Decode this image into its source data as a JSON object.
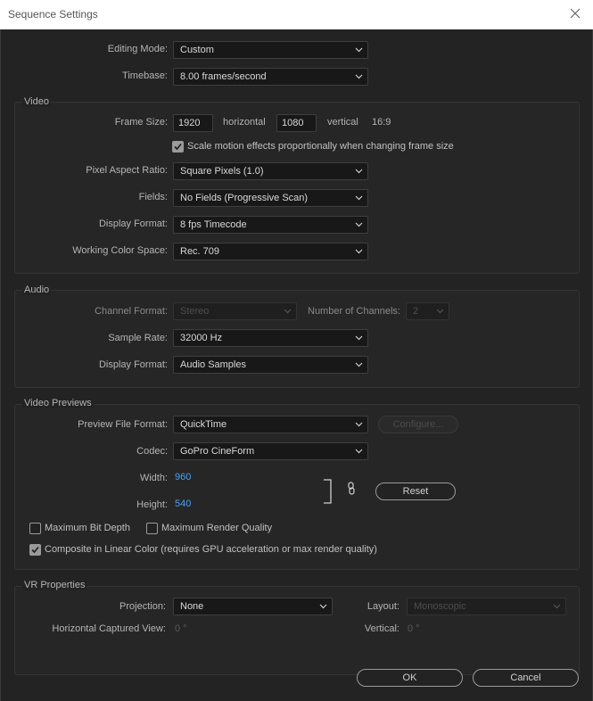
{
  "window": {
    "title": "Sequence Settings"
  },
  "editing_mode": {
    "label": "Editing Mode:",
    "value": "Custom"
  },
  "timebase": {
    "label": "Timebase:",
    "value": "8.00  frames/second"
  },
  "video": {
    "title": "Video",
    "frame_size_label": "Frame Size:",
    "width": "1920",
    "horizontal_label": "horizontal",
    "height": "1080",
    "vertical_label": "vertical",
    "aspect": "16:9",
    "scale_motion": {
      "label": "Scale motion effects proportionally when changing frame size",
      "checked": true
    },
    "pixel_aspect": {
      "label": "Pixel Aspect Ratio:",
      "value": "Square Pixels (1.0)"
    },
    "fields": {
      "label": "Fields:",
      "value": "No Fields (Progressive Scan)"
    },
    "display_format": {
      "label": "Display Format:",
      "value": "8 fps Timecode"
    },
    "color_space": {
      "label": "Working Color Space:",
      "value": "Rec. 709"
    }
  },
  "audio": {
    "title": "Audio",
    "channel_format": {
      "label": "Channel Format:",
      "value": "Stereo"
    },
    "num_channels": {
      "label": "Number of Channels:",
      "value": "2"
    },
    "sample_rate": {
      "label": "Sample Rate:",
      "value": "32000 Hz"
    },
    "display_format": {
      "label": "Display Format:",
      "value": "Audio Samples"
    }
  },
  "previews": {
    "title": "Video Previews",
    "file_format": {
      "label": "Preview File Format:",
      "value": "QuickTime"
    },
    "configure_label": "Configure...",
    "codec": {
      "label": "Codec:",
      "value": "GoPro CineForm"
    },
    "width_label": "Width:",
    "width_value": "960",
    "height_label": "Height:",
    "height_value": "540",
    "reset_label": "Reset",
    "max_bit_depth": {
      "label": "Maximum Bit Depth",
      "checked": false
    },
    "max_render_quality": {
      "label": "Maximum Render Quality",
      "checked": false
    },
    "composite_linear": {
      "label": "Composite in Linear Color (requires GPU acceleration or max render quality)",
      "checked": true
    }
  },
  "vr": {
    "title": "VR Properties",
    "projection": {
      "label": "Projection:",
      "value": "None"
    },
    "layout": {
      "label": "Layout:",
      "value": "Monoscopic"
    },
    "h_captured": {
      "label": "Horizontal Captured View:",
      "value": "0 °"
    },
    "vertical": {
      "label": "Vertical:",
      "value": "0 °"
    }
  },
  "buttons": {
    "ok": "OK",
    "cancel": "Cancel"
  },
  "colors": {
    "accent_blue": "#4a9ff5",
    "dialog_bg": "#232323",
    "titlebar_bg": "#ffffff"
  }
}
